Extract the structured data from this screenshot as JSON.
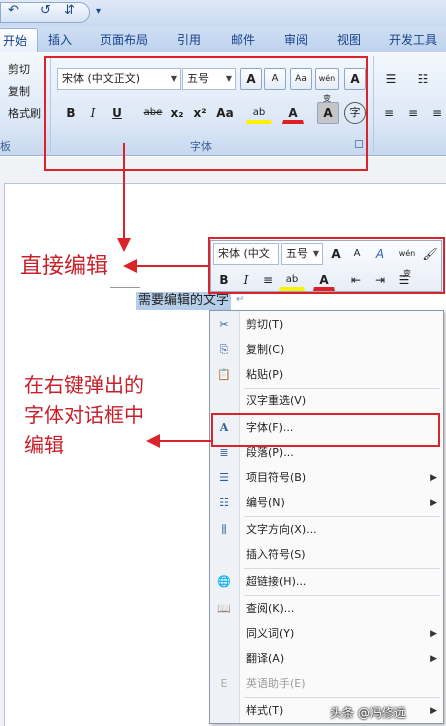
{
  "qat": {
    "undo": "↶",
    "redo": "↺",
    "more": "⇵",
    "dropdown": "▾"
  },
  "tabs": [
    "开始",
    "插入",
    "页面布局",
    "引用",
    "邮件",
    "审阅",
    "视图",
    "开发工具"
  ],
  "clipboard": {
    "cut": "剪切",
    "copy": "复制",
    "painter": "格式刷",
    "group_label": "板"
  },
  "font_group": {
    "font_name": "宋体 (中文正文)",
    "font_size": "五号",
    "grow": "A",
    "shrink": "A",
    "clear": "Aa",
    "phonetic": "wén 变",
    "border_char": "A",
    "bold": "B",
    "italic": "I",
    "underline": "U",
    "strike": "abe",
    "sub": "x₂",
    "sup": "x²",
    "case": "Aa",
    "highlight": "ab",
    "font_color": "A",
    "shade_char": "A",
    "enclose": "字",
    "group_label": "字体"
  },
  "annotations": {
    "direct_edit": "直接编辑",
    "right_click_edit": "在右键弹出的\n字体对话框中\n编辑"
  },
  "document": {
    "selected_text": "需要编辑的文字"
  },
  "mini_toolbar": {
    "font_name": "宋体 (中文",
    "font_size": "五号",
    "grow": "A",
    "shrink": "A",
    "styles": "A",
    "phonetic": "wén 变",
    "painter": "🖌",
    "bold": "B",
    "italic": "I",
    "center": "≡",
    "highlight": "ab",
    "font_color": "A",
    "dec_indent": "⇤",
    "inc_indent": "⇥",
    "bullets": "☰"
  },
  "context_menu": [
    {
      "label": "剪切(T)",
      "icon": "✂",
      "name": "cut"
    },
    {
      "label": "复制(C)",
      "icon": "⎘",
      "name": "copy"
    },
    {
      "label": "粘贴(P)",
      "icon": "📋",
      "name": "paste"
    },
    {
      "label": "汉字重选(V)",
      "icon": "",
      "name": "reconvert"
    },
    {
      "label": "字体(F)...",
      "icon": "A",
      "name": "font"
    },
    {
      "label": "段落(P)...",
      "icon": "≣",
      "name": "paragraph"
    },
    {
      "label": "项目符号(B)",
      "icon": "☰",
      "name": "bullets",
      "submenu": true
    },
    {
      "label": "编号(N)",
      "icon": "☷",
      "name": "numbering",
      "submenu": true
    },
    {
      "label": "文字方向(X)...",
      "icon": "⫼",
      "name": "text-direction"
    },
    {
      "label": "插入符号(S)",
      "icon": "",
      "name": "insert-symbol"
    },
    {
      "label": "超链接(H)...",
      "icon": "🌐",
      "name": "hyperlink"
    },
    {
      "label": "查阅(K)...",
      "icon": "📖",
      "name": "lookup"
    },
    {
      "label": "同义词(Y)",
      "icon": "",
      "name": "synonyms",
      "submenu": true
    },
    {
      "label": "翻译(A)",
      "icon": "",
      "name": "translate",
      "submenu": true
    },
    {
      "label": "英语助手(E)",
      "icon": "E",
      "name": "english-assistant",
      "disabled": true
    },
    {
      "label": "样式(T)",
      "icon": "",
      "name": "styles",
      "submenu": true
    }
  ],
  "watermark": "头条 @冯修远",
  "colors": {
    "annotation_red": "#d9242c",
    "selection": "#b4cde9",
    "ribbon_blue": "#15428b"
  }
}
